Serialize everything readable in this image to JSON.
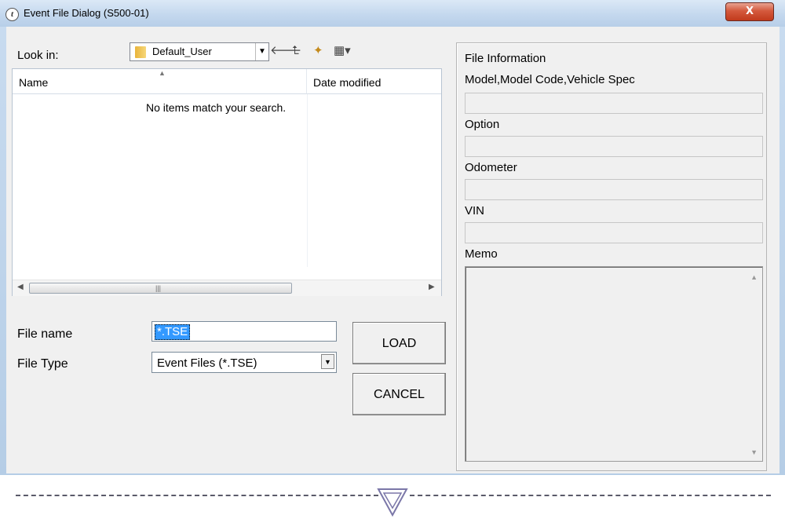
{
  "window": {
    "title": "Event File Dialog (S500-01)",
    "title_icon": "t",
    "close_symbol": "X"
  },
  "lookin": {
    "label": "Look in:",
    "value": "Default_User"
  },
  "toolbar": {
    "back_icon": "🡐",
    "up_icon": "⮤",
    "new_folder_icon": "✦",
    "view_icon": "▦▾"
  },
  "list": {
    "columns": [
      "Name",
      "Date modified"
    ],
    "empty_message": "No items match your search."
  },
  "file_name": {
    "label": "File name",
    "value": "*.TSE"
  },
  "file_type": {
    "label": "File Type",
    "value": "Event Files (*.TSE)"
  },
  "buttons": {
    "load": "LOAD",
    "cancel": "CANCEL"
  },
  "info": {
    "title": "File Information",
    "fields": [
      {
        "label": "Model,Model Code,Vehicle Spec",
        "value": ""
      },
      {
        "label": "Option",
        "value": ""
      },
      {
        "label": "Odometer",
        "value": ""
      },
      {
        "label": "VIN",
        "value": ""
      }
    ],
    "memo_label": "Memo",
    "memo_value": ""
  }
}
